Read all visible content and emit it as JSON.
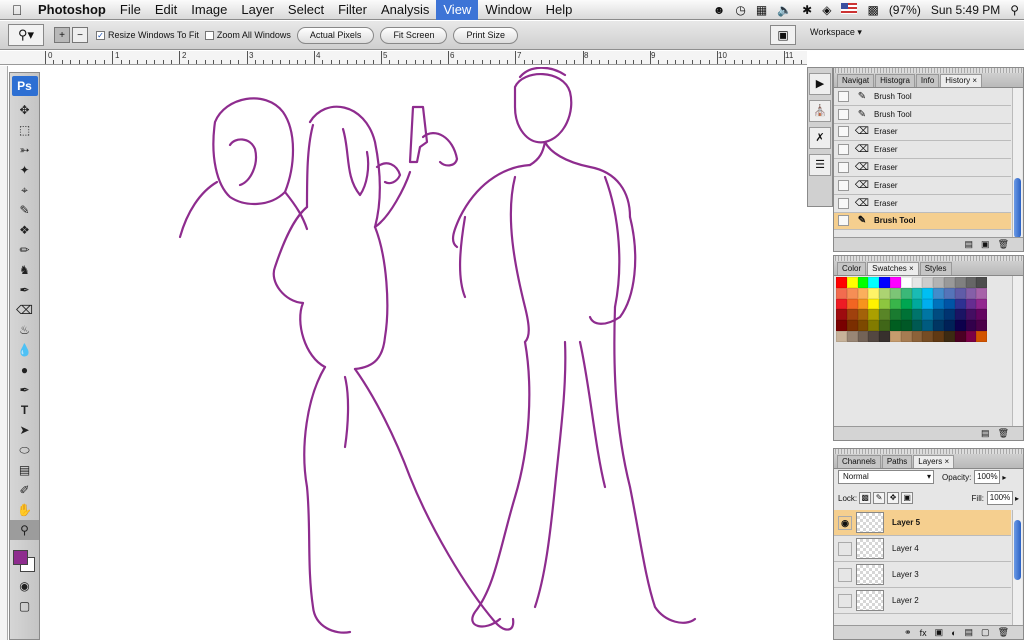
{
  "menubar": {
    "apple_icon": "apple-icon",
    "menus": [
      "Photoshop",
      "File",
      "Edit",
      "Image",
      "Layer",
      "Select",
      "Filter",
      "Analysis",
      "View",
      "Window",
      "Help"
    ],
    "highlighted_menu": "View",
    "battery": "(97%)",
    "clock": "Sun 5:49 PM"
  },
  "options": {
    "resize_windows": "Resize Windows To Fit",
    "resize_checked": true,
    "zoom_all": "Zoom All Windows",
    "zoom_all_checked": false,
    "actual_pixels": "Actual Pixels",
    "fit_screen": "Fit Screen",
    "print_size": "Print Size",
    "workspace": "Workspace ▾"
  },
  "ruler": {
    "labels": [
      "0",
      "1",
      "2",
      "3",
      "4",
      "5",
      "6",
      "7",
      "8",
      "9",
      "10",
      "11"
    ]
  },
  "tools": {
    "ps_label": "Ps",
    "foreground_color": "#8e2c8e",
    "background_color": "#ffffff"
  },
  "history": {
    "tabs": [
      "Navigat",
      "Histogra",
      "Info",
      "History ×"
    ],
    "active_tab": 3,
    "items": [
      {
        "label": "Brush Tool",
        "icon": "brush-icon"
      },
      {
        "label": "Brush Tool",
        "icon": "brush-icon"
      },
      {
        "label": "Eraser",
        "icon": "eraser-icon"
      },
      {
        "label": "Eraser",
        "icon": "eraser-icon"
      },
      {
        "label": "Eraser",
        "icon": "eraser-icon"
      },
      {
        "label": "Eraser",
        "icon": "eraser-icon"
      },
      {
        "label": "Eraser",
        "icon": "eraser-icon"
      },
      {
        "label": "Brush Tool",
        "icon": "brush-icon",
        "current": true
      }
    ]
  },
  "swatches": {
    "tabs": [
      "Color",
      "Swatches ×",
      "Styles"
    ],
    "active_tab": 1
  },
  "layers": {
    "tabs": [
      "Channels",
      "Paths",
      "Layers ×"
    ],
    "active_tab": 2,
    "blend_mode": "Normal",
    "opacity_label": "Opacity:",
    "opacity": "100%",
    "lock_label": "Lock:",
    "fill_label": "Fill:",
    "fill": "100%",
    "items": [
      {
        "name": "Layer 5",
        "visible": true,
        "current": true
      },
      {
        "name": "Layer 4",
        "visible": false
      },
      {
        "name": "Layer 3",
        "visible": false
      },
      {
        "name": "Layer 2",
        "visible": false
      }
    ]
  },
  "colors": {
    "line_art": "#8e2c8e",
    "highlight": "#f5cf8f",
    "selection_blue": "#3d74d6"
  }
}
